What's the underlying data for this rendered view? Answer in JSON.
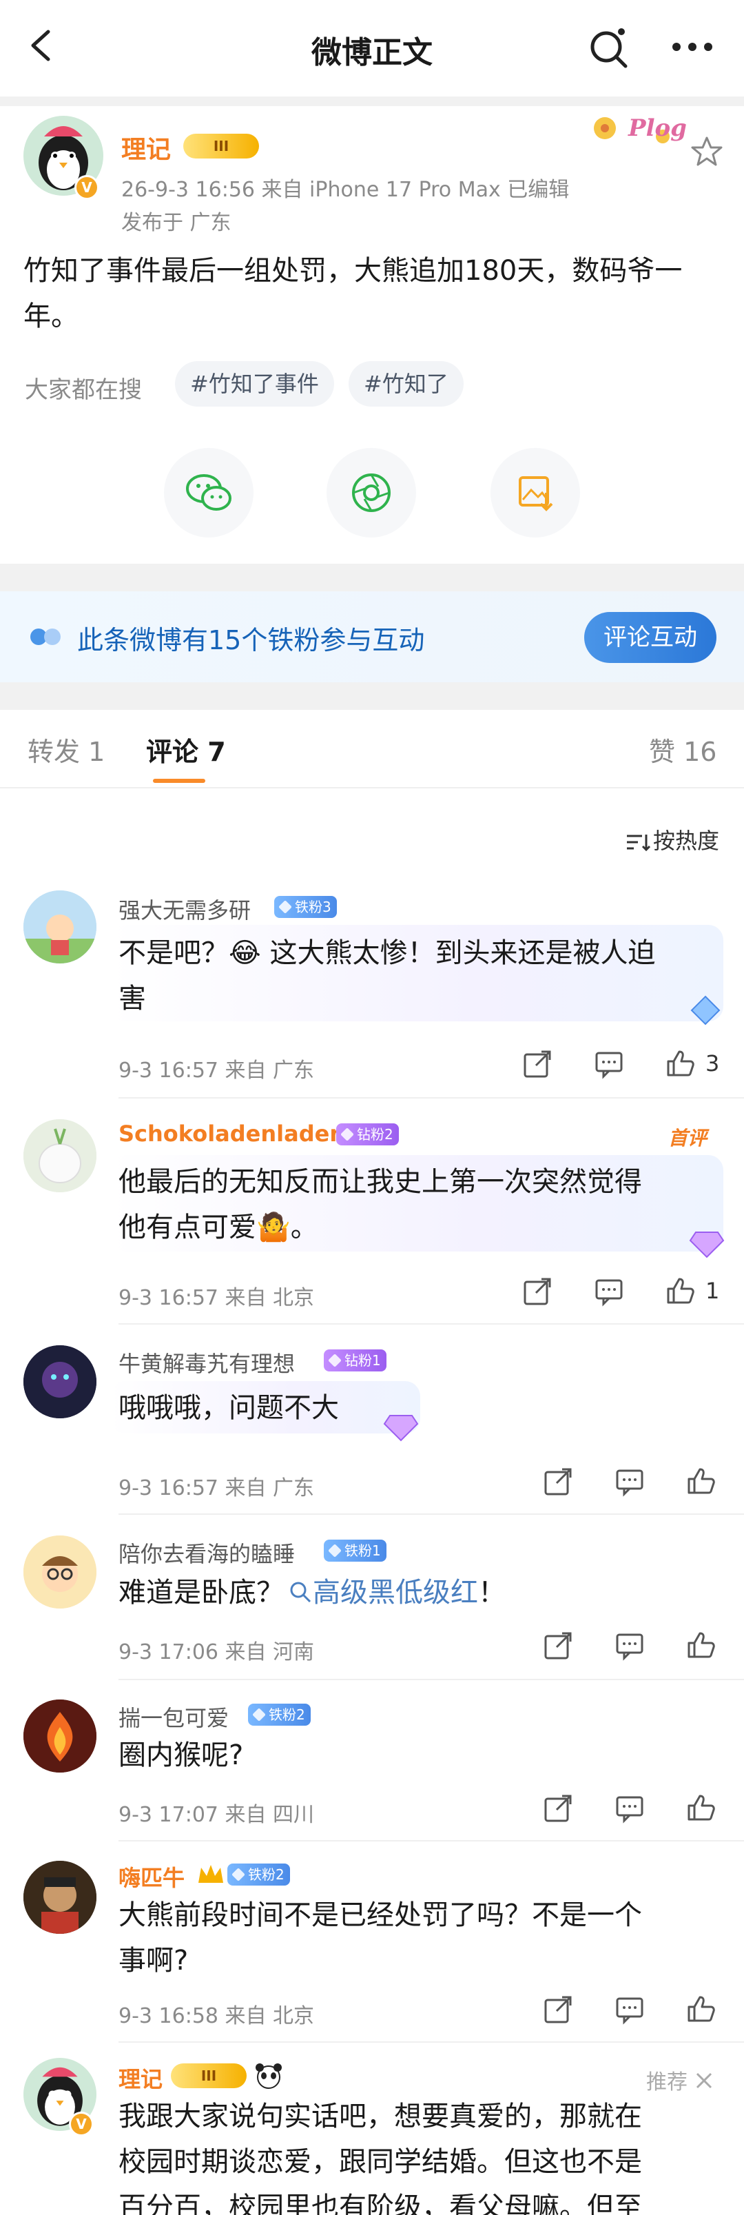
{
  "header": {
    "title": "微博正文"
  },
  "post": {
    "author": "理记",
    "crown_level": "III",
    "verified": "V",
    "time_source": "26-9-3 16:56   来自 iPhone 17 Pro Max   已编辑",
    "published_in": "发布于 广东",
    "body": "竹知了事件最后一组处罚，大熊追加180天，数码爷一年。",
    "search_label": "大家都在搜",
    "tags": [
      "#竹知了事件",
      "#竹知了"
    ],
    "sticker_text": "Plog"
  },
  "fan_bar": {
    "text": "此条微博有15个铁粉参与互动",
    "button": "评论互动"
  },
  "tabs": {
    "repost": "转发 1",
    "comment": "评论 7",
    "like": "赞 16"
  },
  "sort_label": "按热度",
  "comments": [
    {
      "name": "强大无需多研",
      "badge": "铁粉3",
      "text1": "不是吧？😂 这大熊太惨！到头来还是被人迫",
      "text2": "害",
      "meta": "9-3 16:57  来自 广东",
      "likes": "3"
    },
    {
      "name": "Schokoladenladen",
      "badge": "钻粉2",
      "first": "首评",
      "text1": "他最后的无知反而让我史上第一次突然觉得",
      "text2": "他有点可爱🤷。",
      "meta": "9-3 16:57  来自 北京",
      "likes": "1"
    },
    {
      "name": "牛黄解毒艽有理想",
      "badge": "钻粉1",
      "text1": "哦哦哦，问题不大",
      "meta": "9-3 16:57  来自 广东",
      "likes": ""
    },
    {
      "name": "陪你去看海的瞌睡",
      "badge": "铁粉1",
      "text_prefix": "难道是卧底？",
      "link": "高级黑低级红",
      "text_suffix": "！",
      "meta": "9-3 17:06  来自 河南",
      "likes": ""
    },
    {
      "name": "揣一包可爱",
      "badge": "铁粉2",
      "text1": "圈内猴呢?",
      "meta": "9-3 17:07  来自 四川",
      "likes": ""
    },
    {
      "name": "嗨匹牛",
      "badge": "铁粉2",
      "text1": "大熊前段时间不是已经处罚了吗？不是一个",
      "text2": "事啊?",
      "meta": "9-3 16:58  来自 北京",
      "likes": ""
    },
    {
      "name": "理记",
      "badge": "III",
      "recommend": "推荐",
      "text1": "我跟大家说句实话吧，想要真爱的，那就在",
      "text2": "校园时期谈恋爱，跟同学结婚。但这也不是",
      "text3": "百分百，校园里也有阶级，看父母嘛。但至"
    }
  ],
  "colors": {
    "accent": "#f37e22",
    "link": "#4a7fc0",
    "blue": "#2b78d8"
  }
}
